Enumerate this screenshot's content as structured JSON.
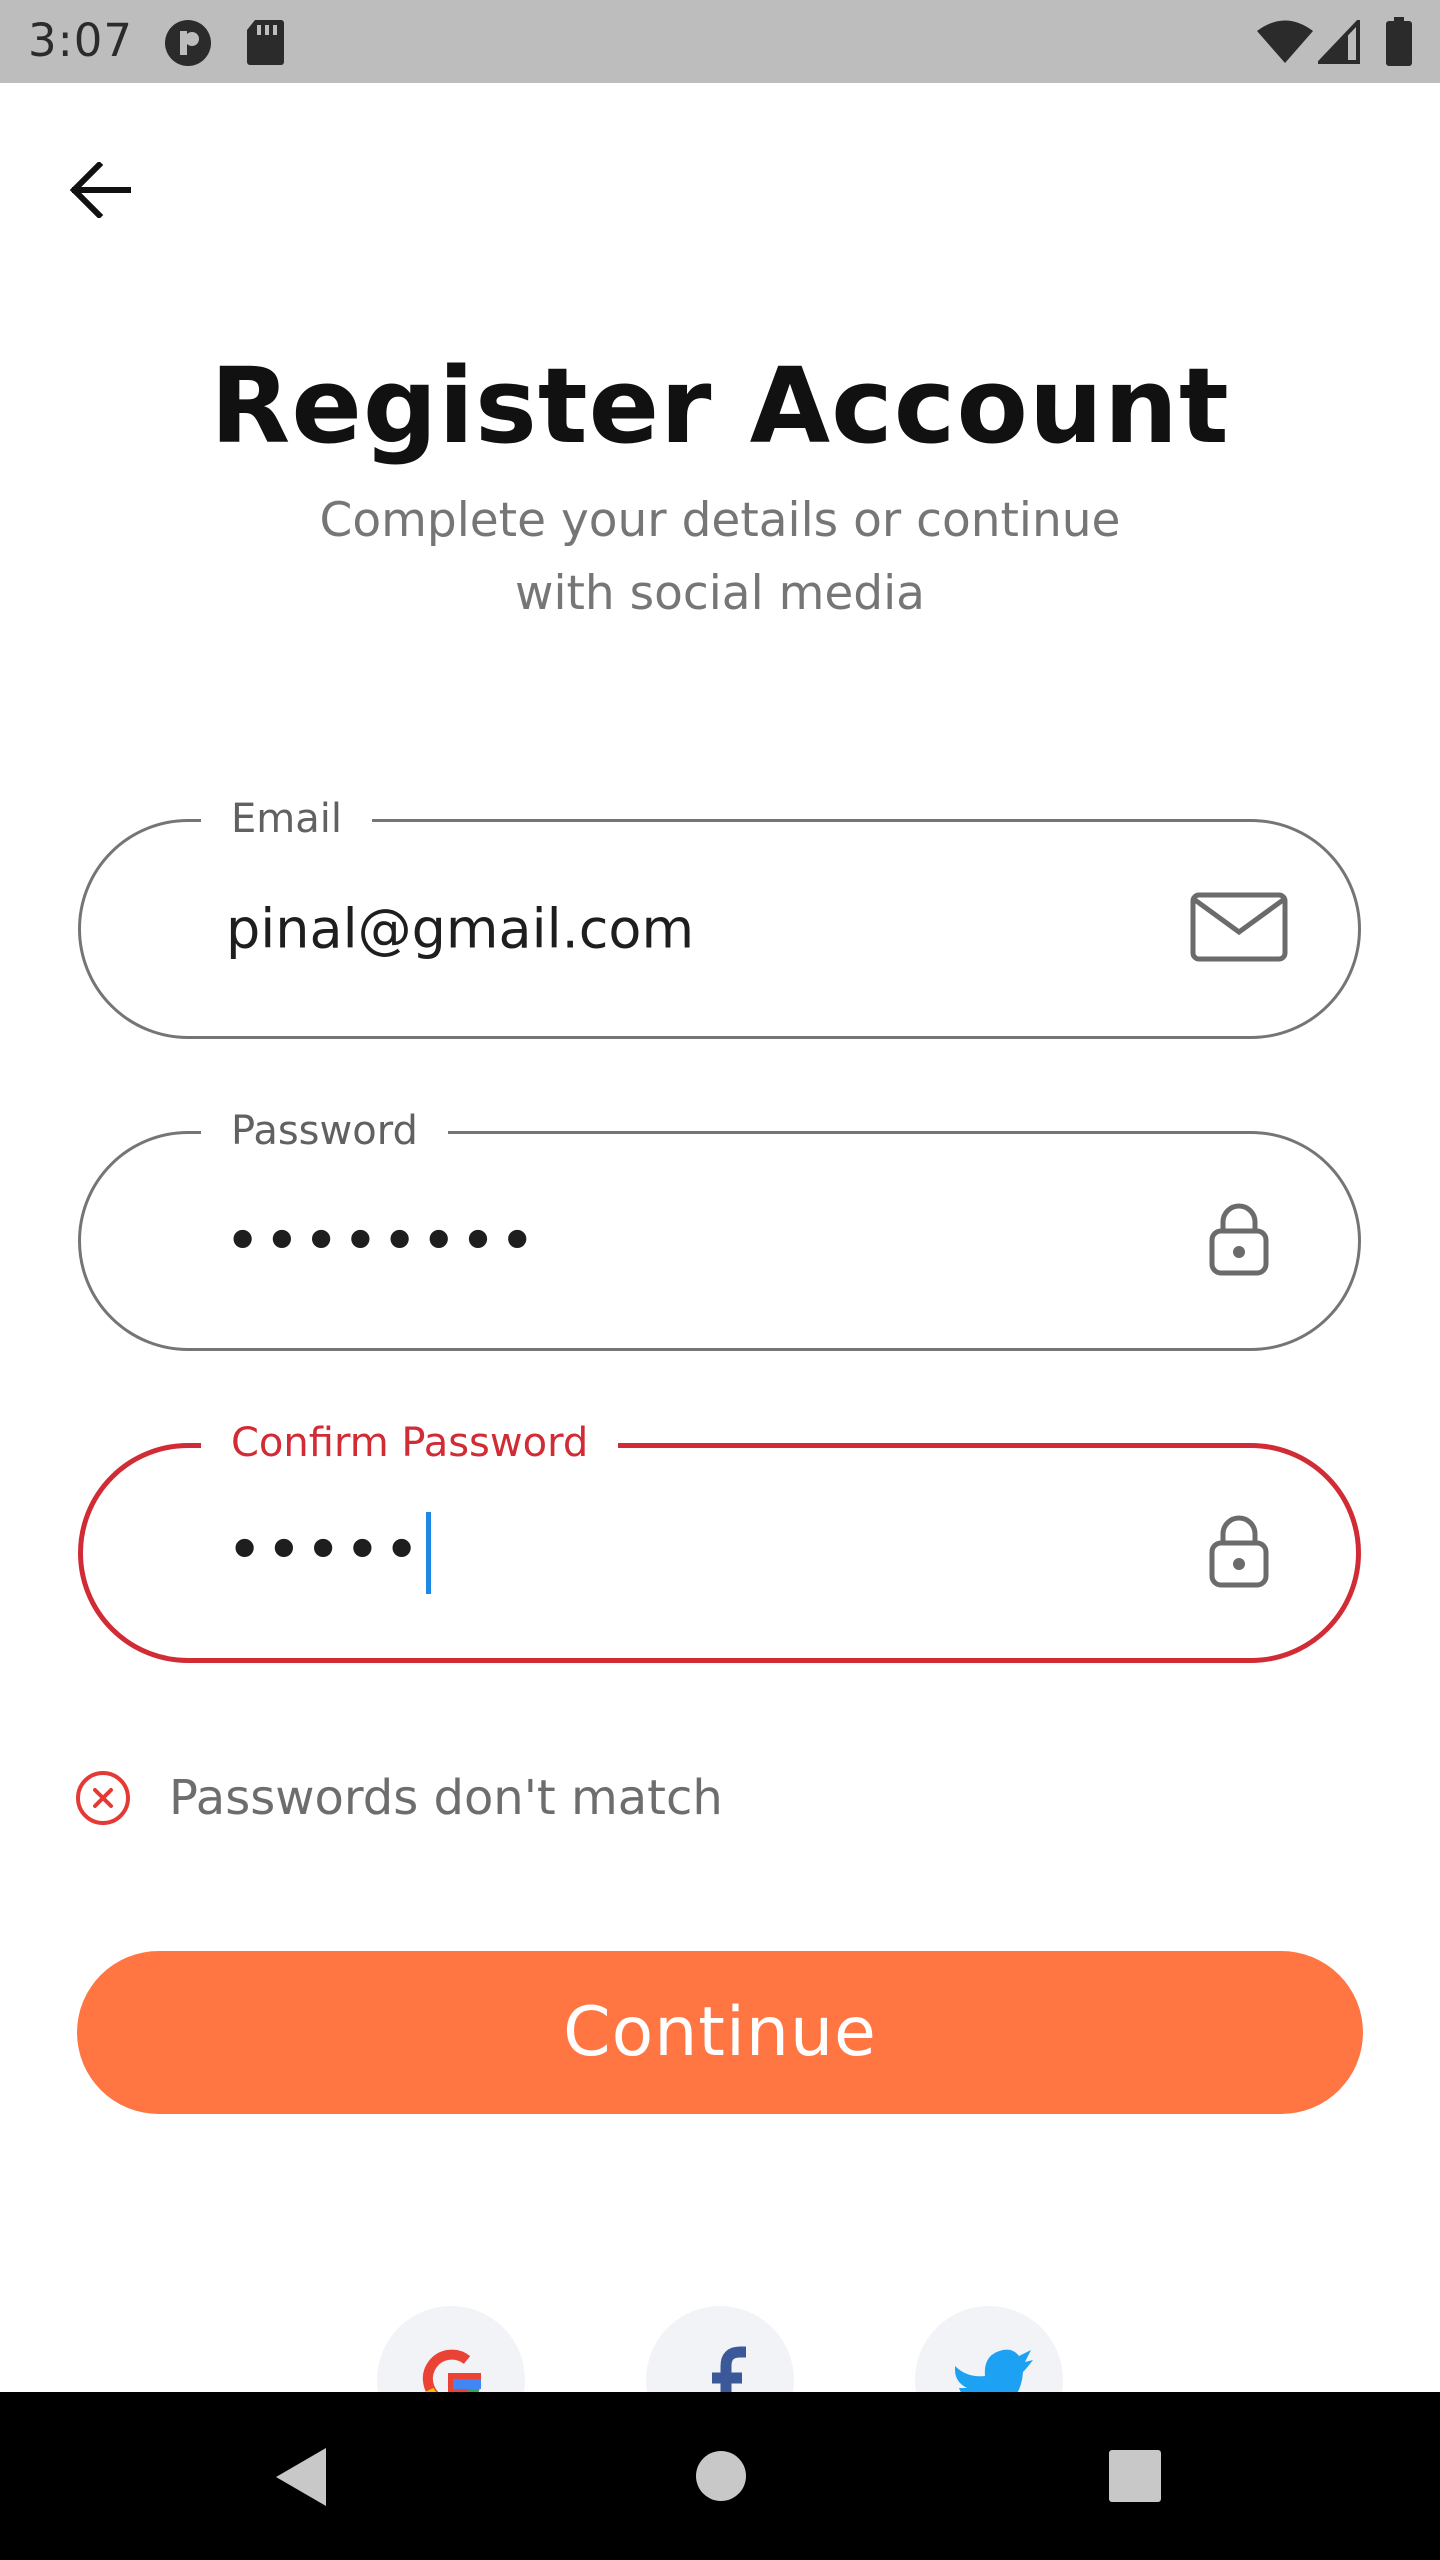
{
  "status_bar": {
    "time": "3:07",
    "icons": [
      "notification-icon",
      "sd-card-icon",
      "wifi-icon",
      "cell-signal-icon",
      "battery-icon"
    ]
  },
  "header": {
    "back_icon": "arrow-left-icon"
  },
  "title": "Register Account",
  "subtitle": "Complete your details or continue with social media",
  "form": {
    "email": {
      "label": "Email",
      "value": "pinal@gmail.com",
      "icon": "mail-icon"
    },
    "password": {
      "label": "Password",
      "value": "••••••••",
      "icon": "lock-icon"
    },
    "confirm_password": {
      "label": "Confirm Password",
      "value": "•••••",
      "icon": "lock-icon",
      "state": "error"
    },
    "error_message": "Passwords don't match"
  },
  "continue_label": "Continue",
  "social": [
    "google-icon",
    "facebook-icon",
    "twitter-icon"
  ],
  "colors": {
    "accent": "#ff7643",
    "error": "#d12c35",
    "caret": "#1e88e5",
    "field_border": "#757575"
  }
}
